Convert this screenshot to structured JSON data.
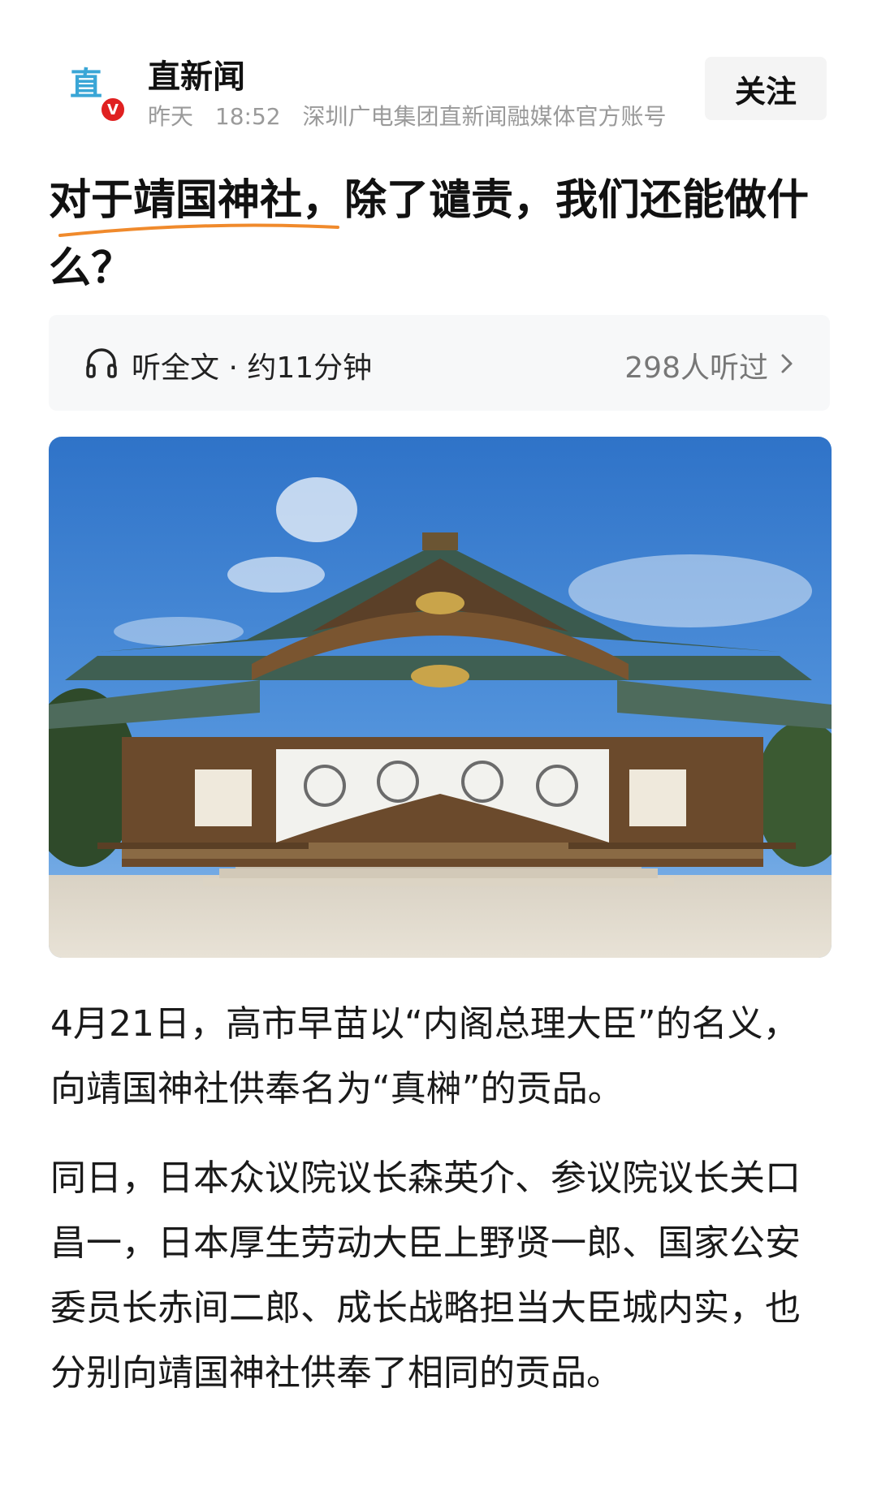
{
  "account": {
    "avatar_glyph": "直",
    "badge": "V",
    "name": "直新闻",
    "date": "昨天",
    "time": "18:52",
    "description": "深圳广电集团直新闻融媒体官方账号",
    "follow_label": "关注"
  },
  "article": {
    "title": "对于靖国神社，除了谴责，我们还能做什么？",
    "listen_label": "听全文 · 约11分钟",
    "listen_count": "298人听过",
    "paragraphs": [
      "4月21日，高市早苗以“内阁总理大臣”的名义，向靖国神社供奉名为“真榊”的贡品。",
      "同日，日本众议院议长森英介、参议院议长关口昌一，日本厚生劳动大臣上野贤一郎、国家公安委员长赤间二郎、成长战略担当大臣城内实，也分别向靖国神社供奉了相同的贡品。"
    ]
  },
  "colors": {
    "underline": "#f08a2c",
    "badge": "#e02020",
    "avatar": "#3aa6d6"
  },
  "icons": {
    "listen": "headphone-icon",
    "more": "chevron-right-icon"
  }
}
